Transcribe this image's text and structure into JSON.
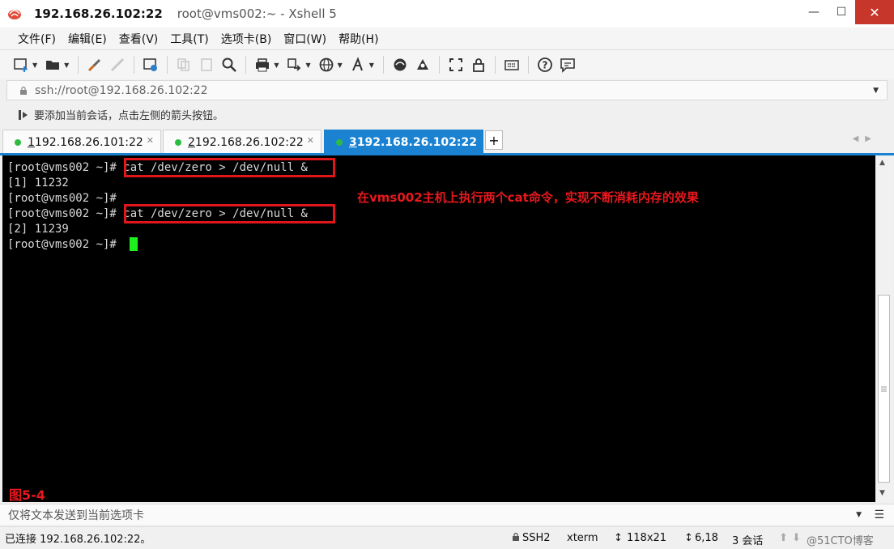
{
  "title": {
    "host": "192.168.26.102:22",
    "rest": "root@vms002:~ - Xshell 5"
  },
  "window_buttons": {
    "minimize": "—",
    "maximize": "☐",
    "close": "✕"
  },
  "menu": [
    "文件(F)",
    "编辑(E)",
    "查看(V)",
    "工具(T)",
    "选项卡(B)",
    "窗口(W)",
    "帮助(H)"
  ],
  "address": {
    "value": "ssh://root@192.168.26.102:22"
  },
  "hint": {
    "text": "要添加当前会话，点击左侧的箭头按钮。"
  },
  "tabs": [
    {
      "num": "1",
      "label": " 192.168.26.101:22"
    },
    {
      "num": "2",
      "label": " 192.168.26.102:22"
    },
    {
      "num": "3",
      "label": " 192.168.26.102:22"
    }
  ],
  "terminal": {
    "lines": [
      "[root@vms002 ~]# cat /dev/zero > /dev/null &",
      "[1] 11232",
      "[root@vms002 ~]#",
      "[root@vms002 ~]# cat /dev/zero > /dev/null &",
      "[2] 11239",
      "[root@vms002 ~]#"
    ],
    "annotation": "在vms002主机上执行两个cat命令，实现不断消耗内存的效果",
    "figure_label": "图5-4"
  },
  "compose": {
    "placeholder": "仅将文本发送到当前选项卡"
  },
  "status": {
    "connection": "已连接 192.168.26.102:22。",
    "protocol": "SSH2",
    "term": "xterm",
    "size": "118x21",
    "cursor": "6,18",
    "sessions": "3 会话",
    "watermark": "@51CTO博客"
  },
  "colors": {
    "accent": "#1a82d0",
    "annotation": "#e8181d",
    "cursor": "#1ef01e",
    "tab_dot": "#2dbb43"
  }
}
